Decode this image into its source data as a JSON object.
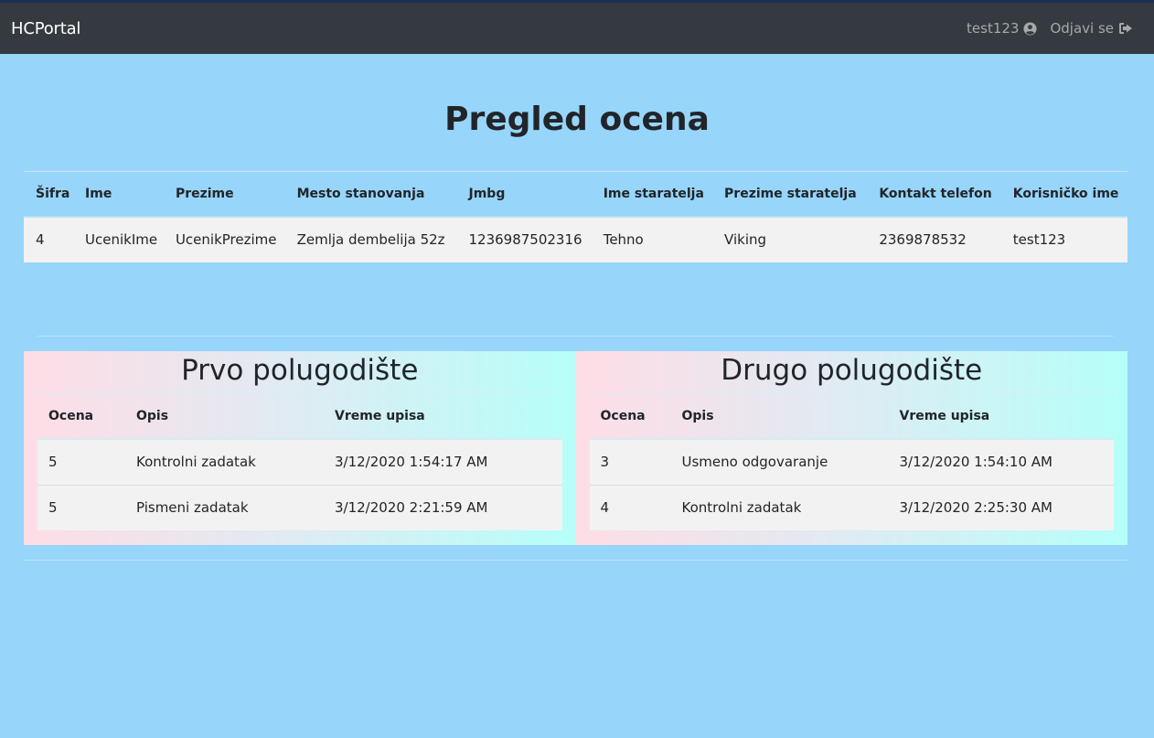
{
  "navbar": {
    "brand": "HCPortal",
    "username": "test123",
    "user_icon": "user-circle-icon",
    "logout_label": "Odjavi se",
    "logout_icon": "sign-out-icon"
  },
  "page": {
    "title": "Pregled ocena"
  },
  "student": {
    "headers": [
      "Šifra",
      "Ime",
      "Prezime",
      "Mesto stanovanja",
      "Jmbg",
      "Ime staratelja",
      "Prezime staratelja",
      "Kontakt telefon",
      "Korisničko ime"
    ],
    "row": [
      "4",
      "UcenikIme",
      "UcenikPrezime",
      "Zemlja dembelija 52z",
      "1236987502316",
      "Tehno",
      "Viking",
      "2369878532",
      "test123"
    ]
  },
  "semesters": [
    {
      "title": "Prvo polugodište",
      "headers": [
        "Ocena",
        "Opis",
        "Vreme upisa"
      ],
      "rows": [
        [
          "5",
          "Kontrolni zadatak",
          "3/12/2020 1:54:17 AM"
        ],
        [
          "5",
          "Pismeni zadatak",
          "3/12/2020 2:21:59 AM"
        ]
      ]
    },
    {
      "title": "Drugo polugodište",
      "headers": [
        "Ocena",
        "Opis",
        "Vreme upisa"
      ],
      "rows": [
        [
          "3",
          "Usmeno odgovaranje",
          "3/12/2020 1:54:10 AM"
        ],
        [
          "4",
          "Kontrolni zadatak",
          "3/12/2020 2:25:30 AM"
        ]
      ]
    }
  ],
  "colors": {
    "background": "#97d5fb",
    "navbar": "#343a40",
    "row_background": "#f2f2f2",
    "gradient_start": "#ffdde6",
    "gradient_end": "#b6fff9"
  }
}
